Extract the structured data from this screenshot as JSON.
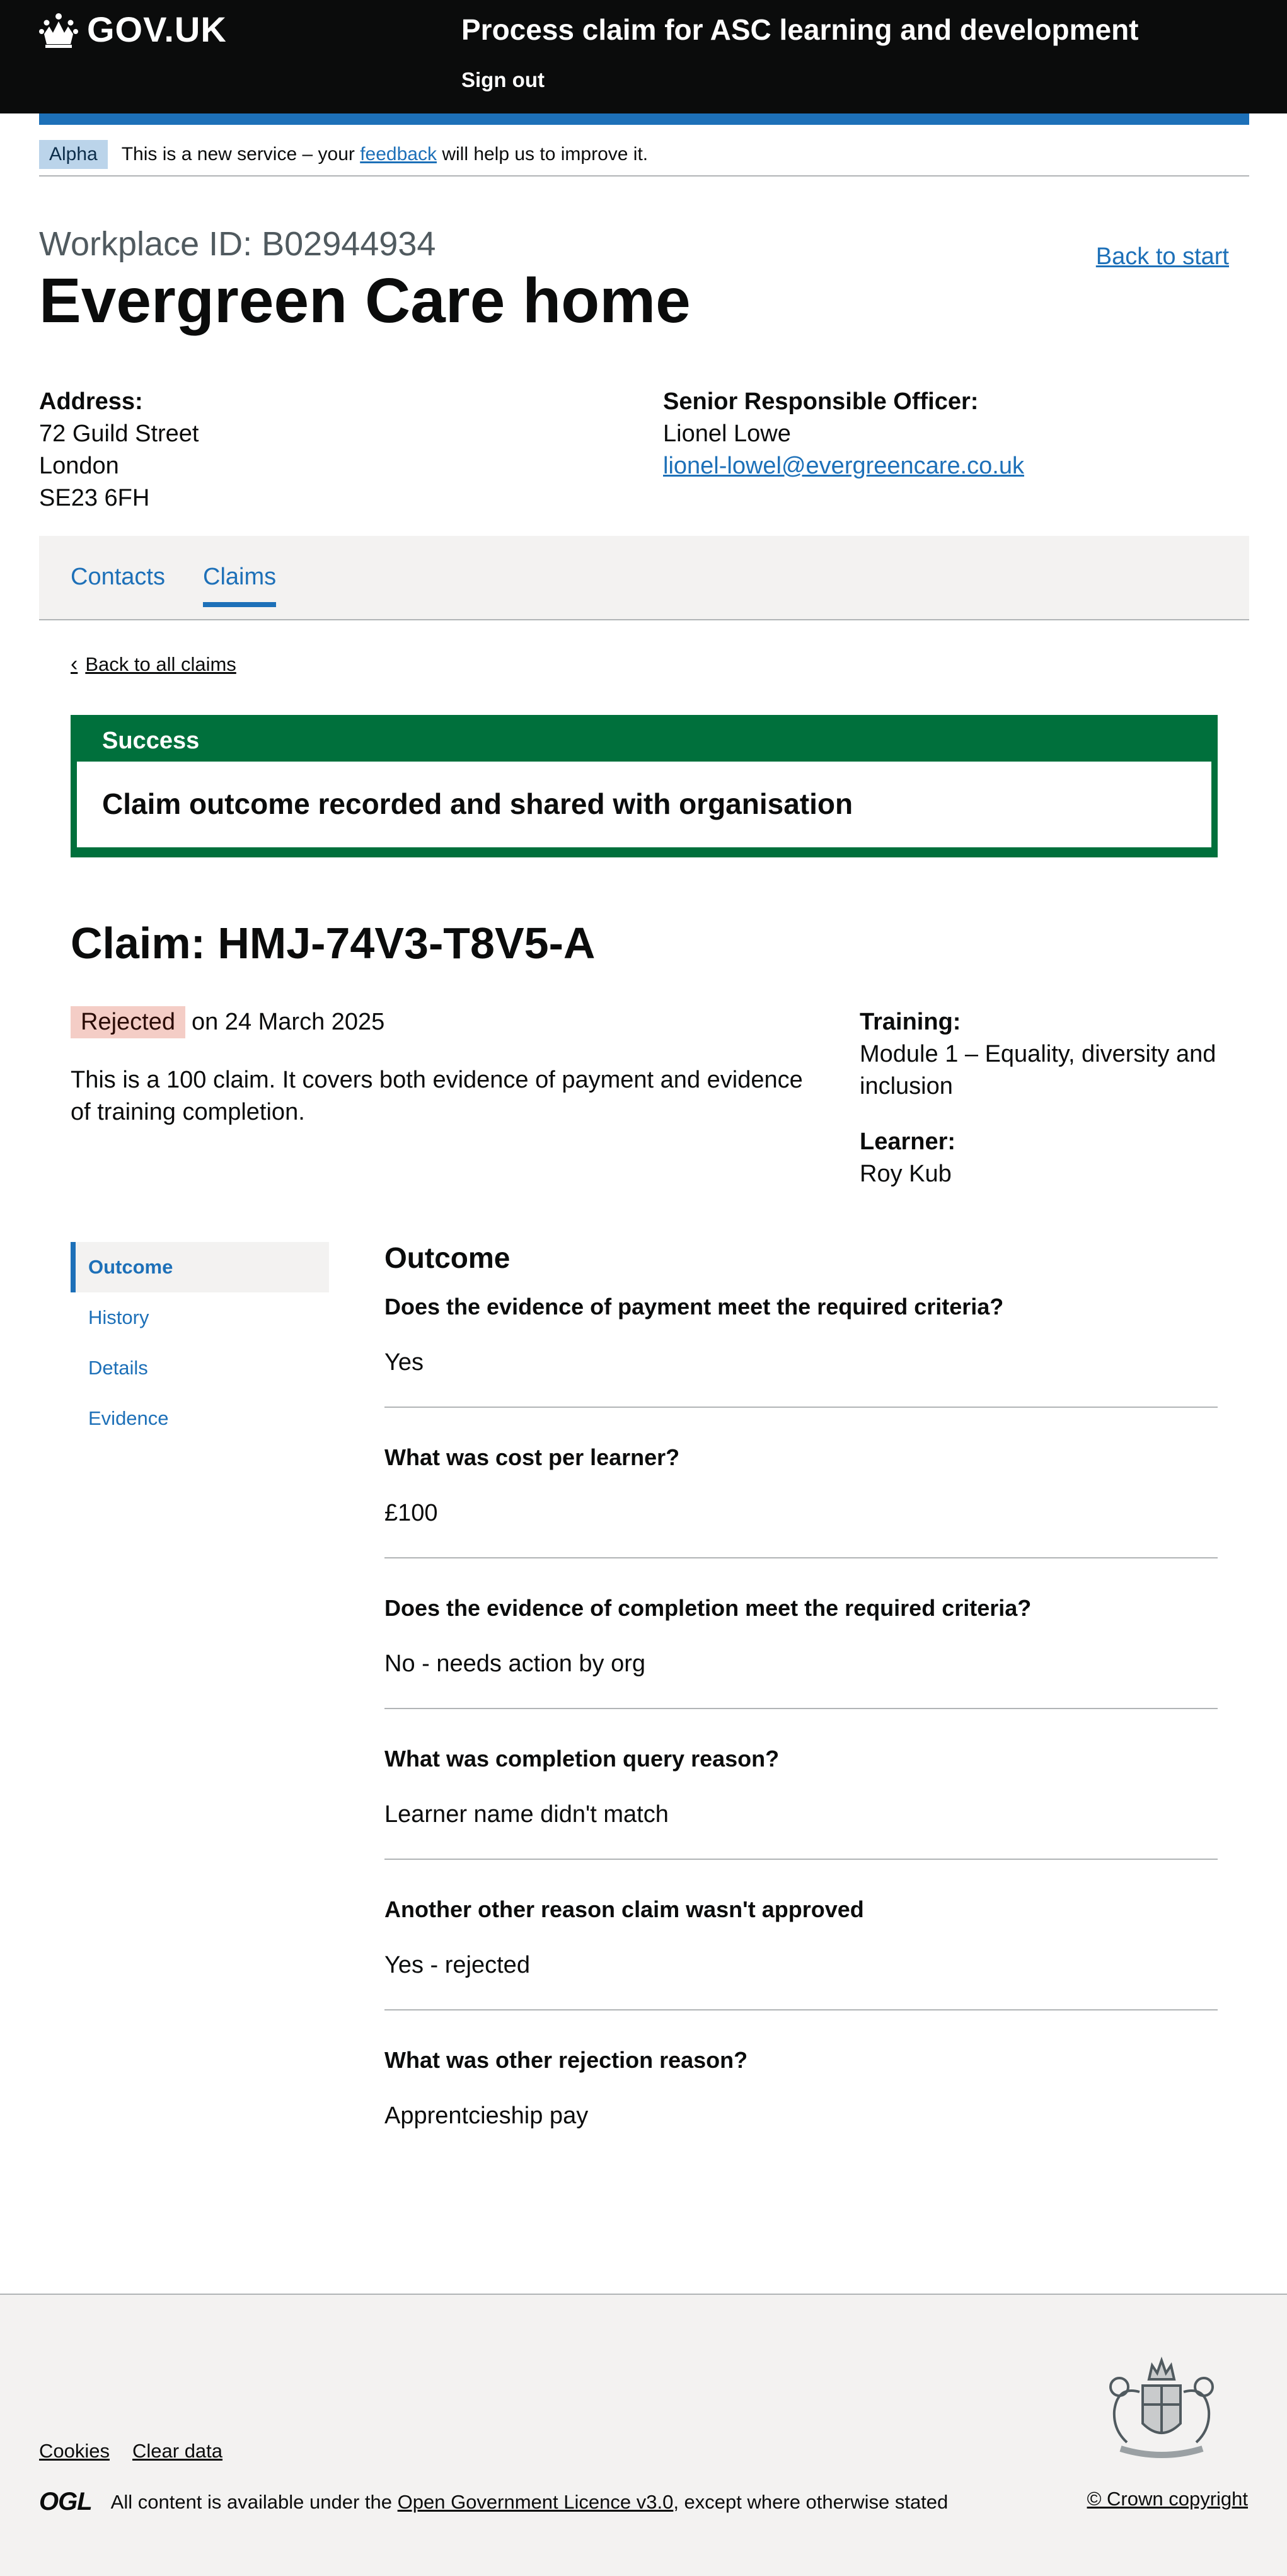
{
  "header": {
    "logo_text": "GOV.UK",
    "service_name": "Process claim for ASC learning and development",
    "sign_out": "Sign out"
  },
  "phase_banner": {
    "tag": "Alpha",
    "text_before": "This is a new service – your ",
    "link": "feedback",
    "text_after": " will help us to improve it."
  },
  "workplace": {
    "caption": "Workplace ID: B02944934",
    "name": "Evergreen Care home",
    "back_to_start": "Back to start",
    "address_label": "Address:",
    "address_lines": [
      "72 Guild Street",
      "London",
      "SE23 6FH"
    ],
    "sro_label": "Senior Responsible Officer:",
    "sro_name": "Lionel Lowe",
    "sro_email": "lionel-lowel@evergreencare.co.uk"
  },
  "tabs": [
    {
      "label": "Contacts",
      "active": false
    },
    {
      "label": "Claims",
      "active": true
    }
  ],
  "back_link": "Back to all claims",
  "notification": {
    "heading": "Success",
    "body": "Claim outcome recorded and shared with organisation"
  },
  "claim": {
    "title": "Claim: HMJ-74V3-T8V5-A",
    "status": "Rejected",
    "status_date": "on 24 March 2025",
    "description": "This is a 100 claim. It covers both evidence of payment and evidence of training completion.",
    "training_label": "Training:",
    "training_value": "Module 1 – Equality, diversity and inclusion",
    "learner_label": "Learner:",
    "learner_value": "Roy Kub"
  },
  "side_nav": [
    {
      "label": "Outcome",
      "active": true
    },
    {
      "label": "History",
      "active": false
    },
    {
      "label": "Details",
      "active": false
    },
    {
      "label": "Evidence",
      "active": false
    }
  ],
  "outcome": {
    "heading": "Outcome",
    "items": [
      {
        "question": "Does the evidence of payment meet the required criteria?",
        "answer": "Yes"
      },
      {
        "question": "What was cost per learner?",
        "answer": "£100"
      },
      {
        "question": "Does the evidence of completion meet the required criteria?",
        "answer": "No - needs action by org"
      },
      {
        "question": "What was completion query reason?",
        "answer": "Learner name didn't match"
      },
      {
        "question": "Another other reason claim wasn't approved",
        "answer": "Yes - rejected"
      },
      {
        "question": "What was other rejection reason?",
        "answer": "Apprentcieship pay"
      }
    ]
  },
  "footer": {
    "links": [
      "Cookies",
      "Clear data"
    ],
    "licence_logo": "OGL",
    "licence_before": "All content is available under the ",
    "licence_link": "Open Government Licence v3.0",
    "licence_after": ", except where otherwise stated",
    "copyright": "© Crown copyright"
  },
  "colors": {
    "brand_blue": "#1d70b8",
    "success_green": "#00703c",
    "rejected_tag_bg": "#f4cdc6",
    "header_black": "#0b0c0c",
    "footer_grey": "#f3f2f1"
  }
}
